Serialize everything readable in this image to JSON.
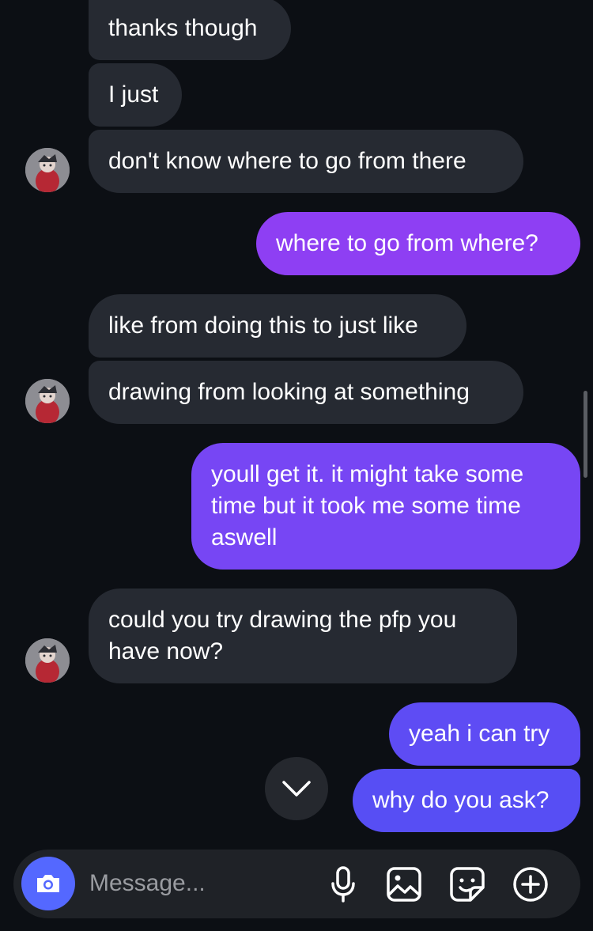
{
  "colors": {
    "background": "#0c0f14",
    "received_bubble": "#262a32",
    "sent_gradient_top": "#8f3ff3",
    "sent_gradient_bottom": "#5a4df4",
    "accent": "#5468ff"
  },
  "messages": [
    {
      "direction": "received",
      "text": "thanks though"
    },
    {
      "direction": "received",
      "text": "I just"
    },
    {
      "direction": "received",
      "text": "don't know where to go from there",
      "avatar": true
    },
    {
      "direction": "sent",
      "text": "where to go from where?"
    },
    {
      "direction": "received",
      "text": "like from doing this to just like"
    },
    {
      "direction": "received",
      "text": "drawing from looking at something",
      "avatar": true
    },
    {
      "direction": "sent",
      "text": "youll get it. it might take some time but it took me some time aswell"
    },
    {
      "direction": "received",
      "text": "could you try drawing the pfp you have now?",
      "avatar": true
    },
    {
      "direction": "sent",
      "text": "yeah i can try"
    },
    {
      "direction": "sent",
      "text": "why do you ask?"
    }
  ],
  "composer": {
    "placeholder": "Message...",
    "value": "",
    "icons": [
      "camera-icon",
      "microphone-icon",
      "image-icon",
      "sticker-icon",
      "plus-circle-icon"
    ]
  },
  "scroll_down_icon": "chevron-down-icon"
}
